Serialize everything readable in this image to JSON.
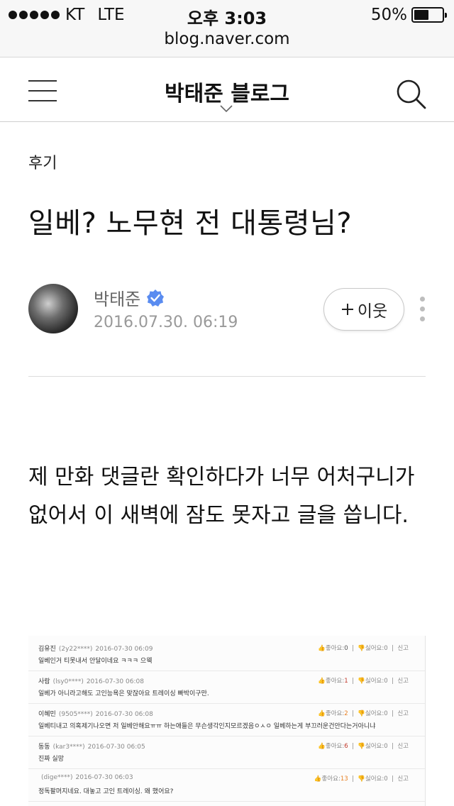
{
  "status_bar": {
    "carrier": "KT",
    "network": "LTE",
    "time": "오후 3:03",
    "battery_percent": "50%",
    "battery_level": 0.5,
    "url": "blog.naver.com"
  },
  "nav": {
    "blog_title": "박태준 블로그",
    "icons": [
      "menu-icon",
      "chevron-down-icon",
      "search-icon"
    ]
  },
  "post": {
    "category": "후기",
    "title": "일베? 노무현 전 대통령님?",
    "author": "박태준",
    "date": "2016.07.30. 06:19",
    "neighbor_button": "이웃",
    "body": "제 만화 댓글란 확인하다가 너무 어처구니가 없어서 이 새벽에 잠도 못자고 글을 씁니다."
  },
  "comments": [
    {
      "name": "김유진",
      "id": "(2y22****)",
      "datetime": "2016-07-30 06:09",
      "text": "일베인거 티못내서 안달이네요 ㅋㅋㅋ 으웩",
      "like_label": "좋아요",
      "like": "0",
      "dislike_label": "싫어요",
      "dislike": "0",
      "report": "신고"
    },
    {
      "name": "사람",
      "id": "(lsy0****)",
      "datetime": "2016-07-30 06:08",
      "text": "일베가 아니라고해도 고인능욕은 맞잖아요 트레이싱 빠박이구만.",
      "like_label": "좋아요",
      "like": "1",
      "dislike_label": "싫어요",
      "dislike": "0",
      "report": "신고"
    },
    {
      "name": "이혜민",
      "id": "(9505****)",
      "datetime": "2016-07-30 06:08",
      "text": "일베티내고 의혹제기나오면 저 일베안해요ㅠㅠ 하는애들은 무슨생각인지모르겠음ㅇㅅㅇ 일베하는게 부끄러운건안다는거아니냐",
      "like_label": "좋아요",
      "like": "2",
      "dislike_label": "싫어요",
      "dislike": "0",
      "report": "신고"
    },
    {
      "name": "동동",
      "id": "(kar3****)",
      "datetime": "2016-07-30 06:05",
      "text": "진짜 실망",
      "like_label": "좋아요",
      "like": "6",
      "dislike_label": "싫어요",
      "dislike": "0",
      "report": "신고"
    },
    {
      "name": "",
      "id": "(dige****)",
      "datetime": "2016-07-30 06:03",
      "text": "정독팔머지네요. 대놓고 고인 트레이싱. 왜 했어요?",
      "like_label": "좋아요",
      "like": "13",
      "dislike_label": "싫어요",
      "dislike": "0",
      "report": "신고"
    }
  ]
}
